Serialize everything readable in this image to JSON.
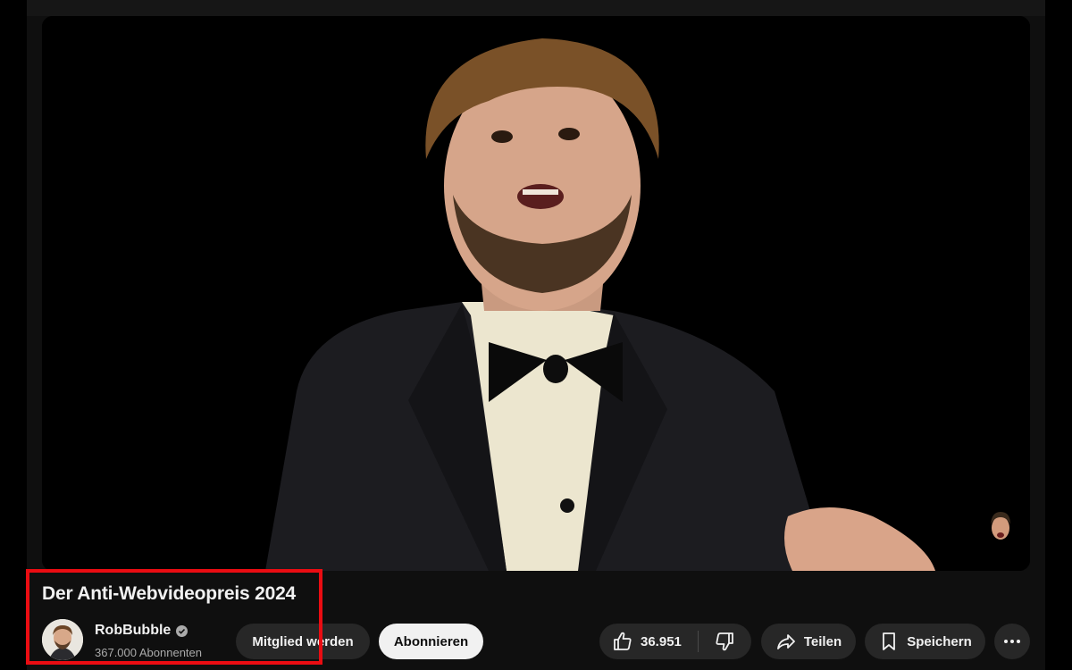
{
  "video": {
    "title": "Der Anti-Webvideopreis 2024"
  },
  "channel": {
    "name": "RobBubble",
    "subscribers": "367.000 Abonnenten",
    "verified": true
  },
  "actions": {
    "member_label": "Mitglied werden",
    "subscribe_label": "Abonnieren",
    "like_count": "36.951",
    "share_label": "Teilen",
    "save_label": "Speichern"
  },
  "icons": {
    "like": "thumbs-up-icon",
    "dislike": "thumbs-down-icon",
    "share": "share-arrow-icon",
    "save": "bookmark-icon",
    "more": "more-horizontal-icon",
    "verified": "verified-check-icon"
  },
  "colors": {
    "background": "#0f0f0f",
    "pill": "#272727",
    "subscribe_bg": "#f1f1f1",
    "highlight": "#ea0c12"
  }
}
